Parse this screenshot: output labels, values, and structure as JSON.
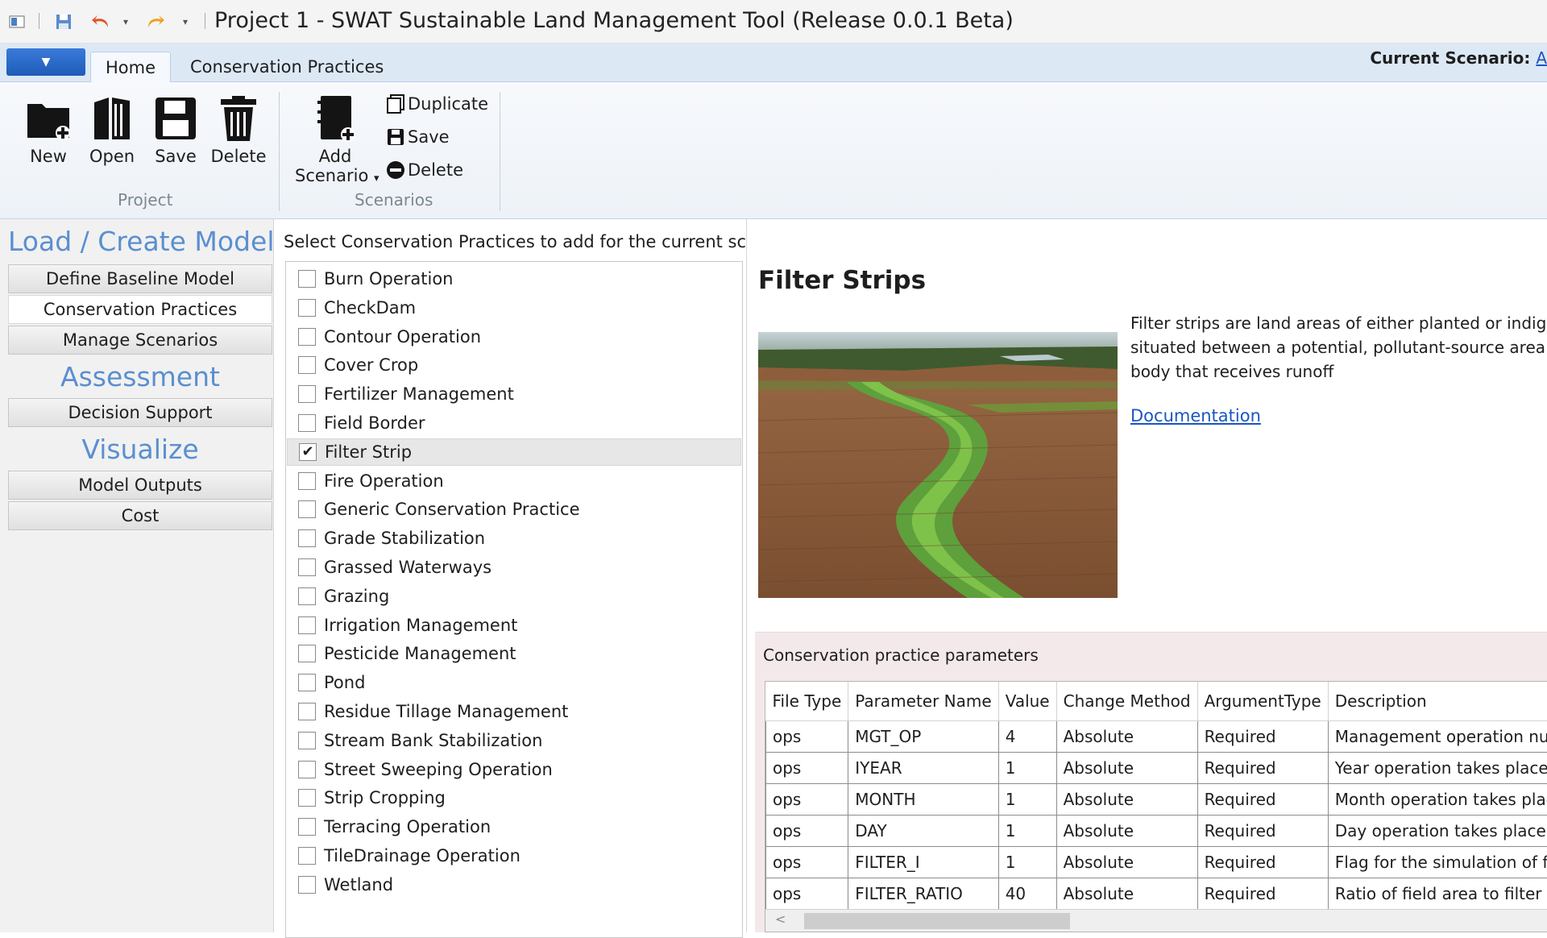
{
  "window": {
    "title": "Project 1 - SWAT Sustainable Land Management Tool (Release 0.0.1 Beta)"
  },
  "ribbon": {
    "tabs": [
      {
        "label": "Home",
        "active": true
      },
      {
        "label": "Conservation Practices",
        "active": false
      }
    ],
    "current_scenario_label": "Current Scenario:",
    "current_scenario_value": "A",
    "project_group": {
      "label": "Project",
      "buttons": [
        {
          "label": "New",
          "icon": "new-folder-icon"
        },
        {
          "label": "Open",
          "icon": "open-book-icon"
        },
        {
          "label": "Save",
          "icon": "floppy-disk-icon"
        },
        {
          "label": "Delete",
          "icon": "trash-can-icon"
        }
      ]
    },
    "scenarios_group": {
      "label": "Scenarios",
      "add_label_line1": "Add",
      "add_label_line2": "Scenario",
      "duplicate_label": "Duplicate",
      "save_label": "Save",
      "delete_label": "Delete"
    }
  },
  "nav": {
    "sections": [
      {
        "heading": "Load / Create Models",
        "items": [
          "Define Baseline Model",
          "Conservation Practices",
          "Manage Scenarios"
        ]
      },
      {
        "heading": "Assessment",
        "items": [
          "Decision Support"
        ]
      },
      {
        "heading": "Visualize",
        "items": [
          "Model Outputs",
          "Cost"
        ]
      }
    ],
    "selected": "Conservation Practices"
  },
  "practices": {
    "heading": "Select Conservation Practices to add for the current scenario",
    "items": [
      {
        "label": "Burn Operation",
        "checked": false
      },
      {
        "label": "CheckDam",
        "checked": false
      },
      {
        "label": "Contour Operation",
        "checked": false
      },
      {
        "label": "Cover Crop",
        "checked": false
      },
      {
        "label": "Fertilizer Management",
        "checked": false
      },
      {
        "label": "Field Border",
        "checked": false
      },
      {
        "label": "Filter Strip",
        "checked": true
      },
      {
        "label": "Fire Operation",
        "checked": false
      },
      {
        "label": "Generic Conservation Practice",
        "checked": false
      },
      {
        "label": "Grade Stabilization",
        "checked": false
      },
      {
        "label": "Grassed Waterways",
        "checked": false
      },
      {
        "label": "Grazing",
        "checked": false
      },
      {
        "label": "Irrigation Management",
        "checked": false
      },
      {
        "label": "Pesticide Management",
        "checked": false
      },
      {
        "label": "Pond",
        "checked": false
      },
      {
        "label": "Residue Tillage Management",
        "checked": false
      },
      {
        "label": "Stream Bank Stabilization",
        "checked": false
      },
      {
        "label": "Street Sweeping Operation",
        "checked": false
      },
      {
        "label": "Strip Cropping",
        "checked": false
      },
      {
        "label": "Terracing Operation",
        "checked": false
      },
      {
        "label": "TileDrainage Operation",
        "checked": false
      },
      {
        "label": "Wetland",
        "checked": false
      }
    ]
  },
  "detail": {
    "title": "Filter Strips",
    "description_lines": [
      "Filter strips are land areas of either planted or indigeno",
      "situated between a potential, pollutant-source area anc",
      "body that receives runoff"
    ],
    "doc_link": "Documentation",
    "params_label": "Conservation practice parameters",
    "columns": [
      "File Type",
      "Parameter Name",
      "Value",
      "Change Method",
      "ArgumentType",
      "Description"
    ],
    "rows": [
      [
        "ops",
        "MGT_OP",
        "4",
        "Absolute",
        "Required",
        "Management operation numb"
      ],
      [
        "ops",
        "IYEAR",
        "1",
        "Absolute",
        "Required",
        "Year operation takes place"
      ],
      [
        "ops",
        "MONTH",
        "1",
        "Absolute",
        "Required",
        "Month operation takes place"
      ],
      [
        "ops",
        "DAY",
        "1",
        "Absolute",
        "Required",
        "Day operation takes place"
      ],
      [
        "ops",
        "FILTER_I",
        "1",
        "Absolute",
        "Required",
        "Flag for the simulation of filte"
      ],
      [
        "ops",
        "FILTER_RATIO",
        "40",
        "Absolute",
        "Required",
        "Ratio of field area to filter stri"
      ]
    ]
  },
  "colors": {
    "accent": "#1f5cb8",
    "nav_heading": "#5a8fd0",
    "link": "#1a56c2",
    "params_bg": "#f4e9ea"
  }
}
